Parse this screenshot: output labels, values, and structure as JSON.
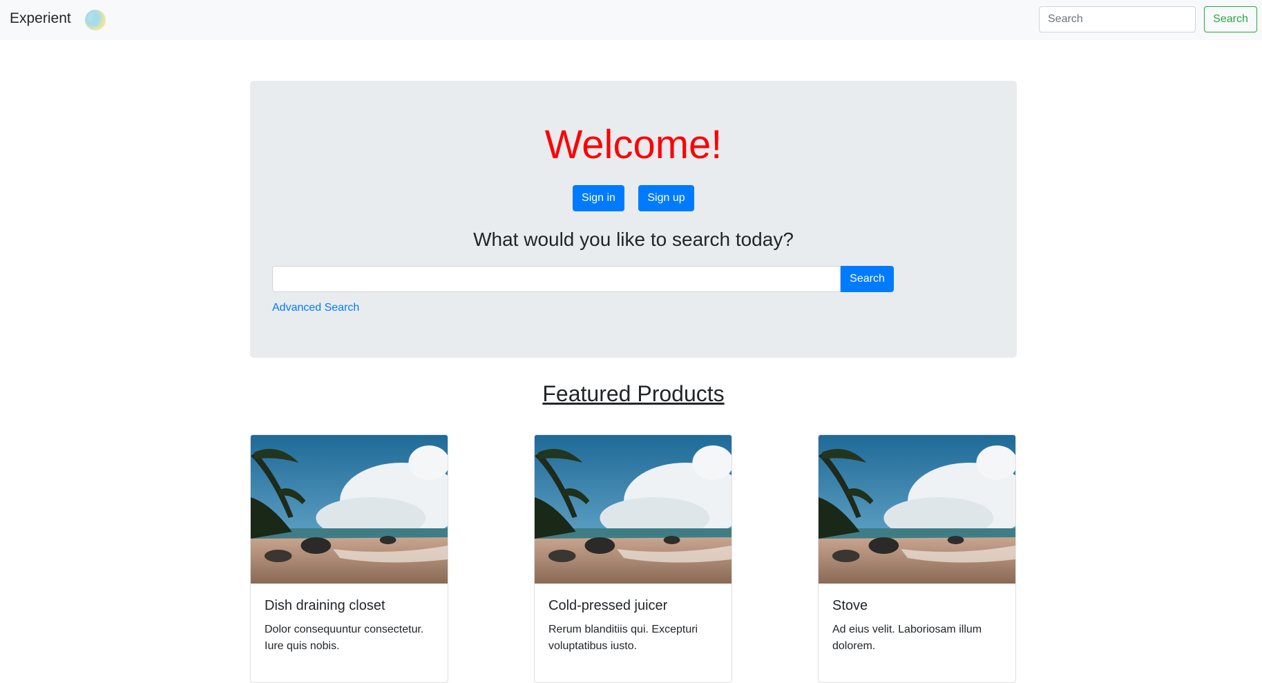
{
  "navbar": {
    "brand": "Experient",
    "search_placeholder": "Search",
    "search_button": "Search"
  },
  "hero": {
    "welcome": "Welcome!",
    "sign_in": "Sign in",
    "sign_up": "Sign up",
    "question": "What would you like to search today?",
    "search_value": "",
    "search_button": "Search",
    "advanced_search": "Advanced Search"
  },
  "featured": {
    "title": "Featured Products",
    "products": [
      {
        "name": "Dish draining closet",
        "description": "Dolor consequuntur consectetur. Iure quis nobis."
      },
      {
        "name": "Cold-pressed juicer",
        "description": "Rerum blanditiis qui. Excepturi voluptatibus iusto."
      },
      {
        "name": "Stove",
        "description": "Ad eius velit. Laboriosam illum dolorem."
      }
    ]
  },
  "colors": {
    "welcome": "#ff0000",
    "primary": "#007bff",
    "success": "#28a745",
    "jumbotron_bg": "#e9ecef",
    "navbar_bg": "#f8f9fa"
  }
}
